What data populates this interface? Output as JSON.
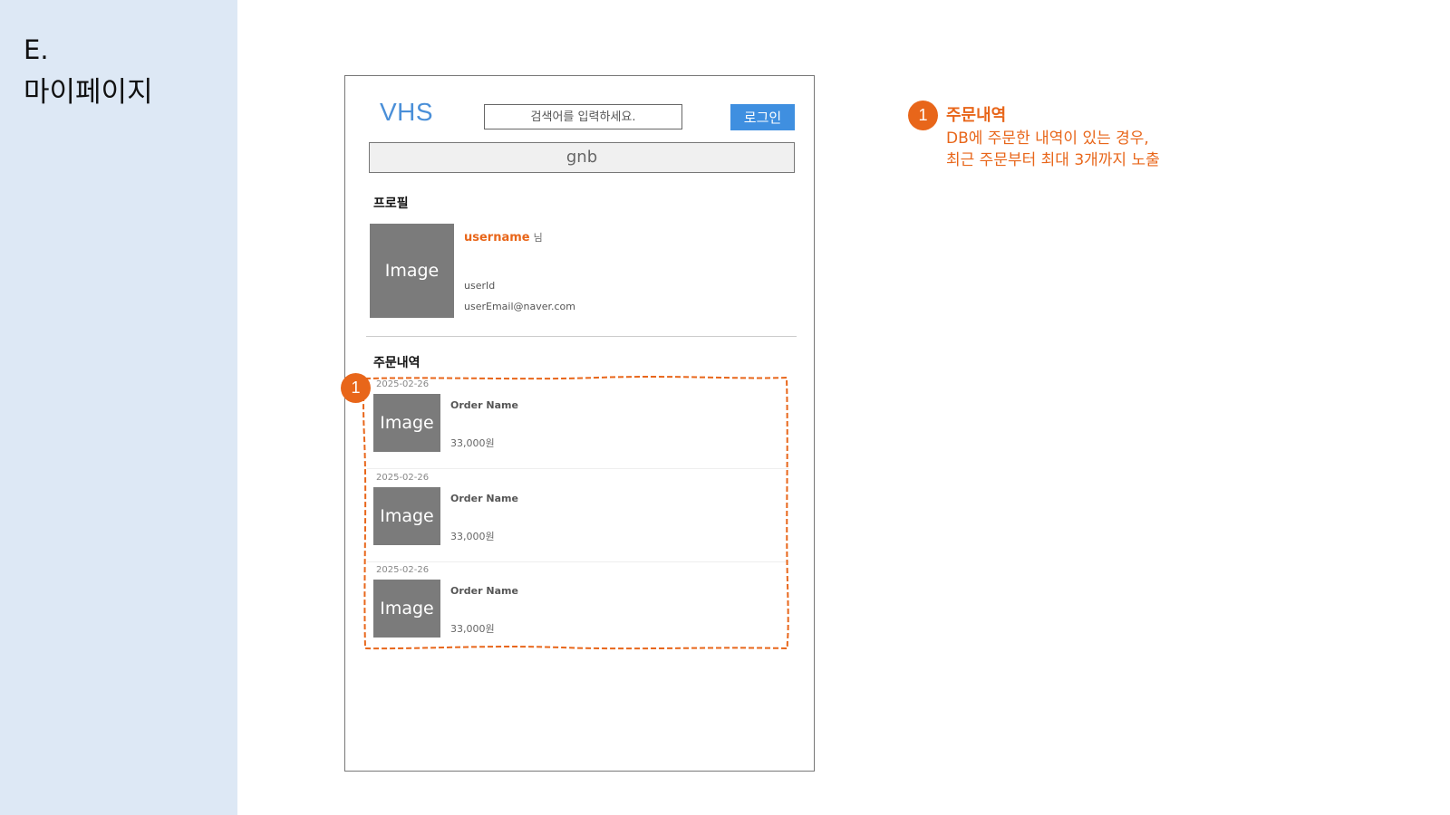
{
  "page": {
    "section_code": "E.",
    "section_title": "마이페이지"
  },
  "header": {
    "logo": "VHS",
    "search_placeholder": "검색어를 입력하세요.",
    "login_label": "로그인",
    "gnb_label": "gnb"
  },
  "profile": {
    "heading": "프로필",
    "image_label": "Image",
    "username": "username",
    "honorific": "님",
    "user_id": "userId",
    "user_email": "userEmail@naver.com"
  },
  "orders": {
    "heading": "주문내역",
    "items": [
      {
        "date": "2025-02-26",
        "image_label": "Image",
        "name": "Order Name",
        "price": "33,000원"
      },
      {
        "date": "2025-02-26",
        "image_label": "Image",
        "name": "Order Name",
        "price": "33,000원"
      },
      {
        "date": "2025-02-26",
        "image_label": "Image",
        "name": "Order Name",
        "price": "33,000원"
      }
    ]
  },
  "annotation": {
    "badge": "1",
    "title": "주문내역",
    "line1": "DB에 주문한 내역이 있는 경우,",
    "line2": "최근 주문부터 최대 3개까지 노출",
    "color": "#e8661a"
  },
  "colors": {
    "side_panel": "#dde8f5",
    "brand_blue": "#3f8fe0",
    "placeholder_gray": "#7b7b7b"
  }
}
